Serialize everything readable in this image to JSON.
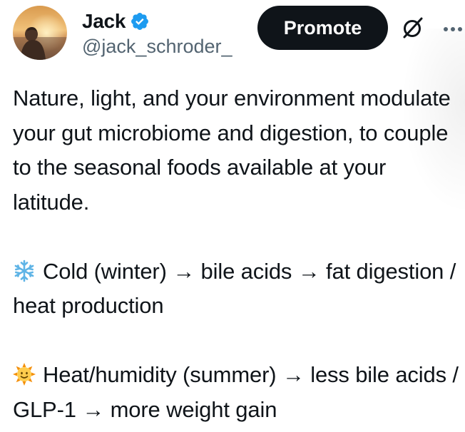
{
  "author": {
    "display_name": "Jack",
    "handle": "@jack_schroder_",
    "verified": true,
    "avatar_icon": "avatar-sunset-photo"
  },
  "actions": {
    "promote_label": "Promote",
    "grok_icon": "grok-icon",
    "more_icon": "more-dots-icon"
  },
  "tweet": {
    "paragraph_1": "Nature, light, and your environment modulate your gut microbiome and digestion, to couple to the seasonal foods available at your latitude.",
    "item_1": {
      "emoji": "snowflake",
      "text": "Cold (winter) → bile acids → fat digestion / heat production"
    },
    "item_2": {
      "emoji": "sun-with-face",
      "text": "Heat/humidity (summer) → less bile acids / GLP-1 → more weight gain"
    }
  },
  "colors": {
    "text": "#0f1419",
    "secondary": "#536471",
    "verified_blue": "#1d9bf0",
    "button_bg": "#0f1419"
  }
}
